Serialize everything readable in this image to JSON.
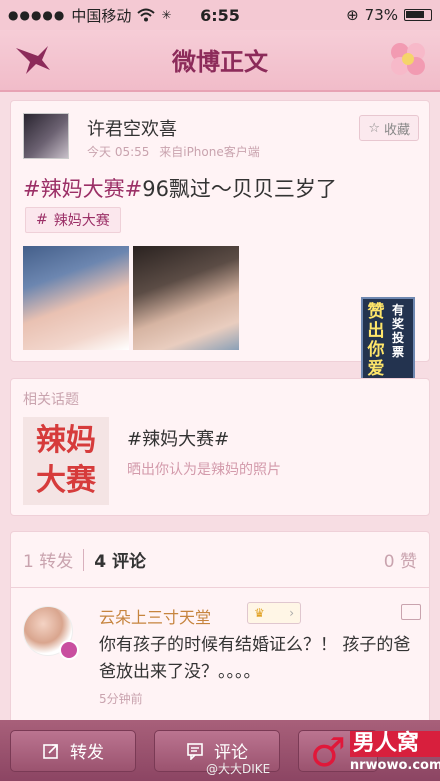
{
  "status_bar": {
    "carrier": "中国移动",
    "time": "6:55",
    "battery": "73%"
  },
  "nav": {
    "title": "微博正文"
  },
  "post": {
    "username": "许君空欢喜",
    "time": "今天 05:55",
    "source": "来自iPhone客户端",
    "favorite_label": "收藏",
    "topic_text": "#辣妈大赛#",
    "body_text": "96飘过～贝贝三岁了",
    "topic_chip": "辣妈大赛"
  },
  "ad": {
    "col1": "赞出你爱的方言",
    "col2": "有奖投票"
  },
  "related": {
    "label": "相关话题",
    "image_line1": "辣妈",
    "image_line2": "大赛",
    "topic_name": "#辣妈大赛#",
    "topic_desc": "晒出你认为是辣妈的照片"
  },
  "stats": {
    "reposts": "1 转发",
    "comments": "4 评论",
    "likes": "0 赞"
  },
  "comment": {
    "username": "云朵上三寸天堂",
    "text": "你有孩子的时候有结婚证么？！ 孩子的爸爸放出来了没？。。。。",
    "time": "5分钟前"
  },
  "toolbar": {
    "repost_label": "转发",
    "comment_label": "评论"
  },
  "watermark": {
    "weibo": "@大大DIKE",
    "logo_cn": "男人窝",
    "logo_en": "nrwowo.com"
  },
  "colors": {
    "accent": "#9b2f66",
    "background": "#f7dde3",
    "toolbar": "#8c4563"
  }
}
